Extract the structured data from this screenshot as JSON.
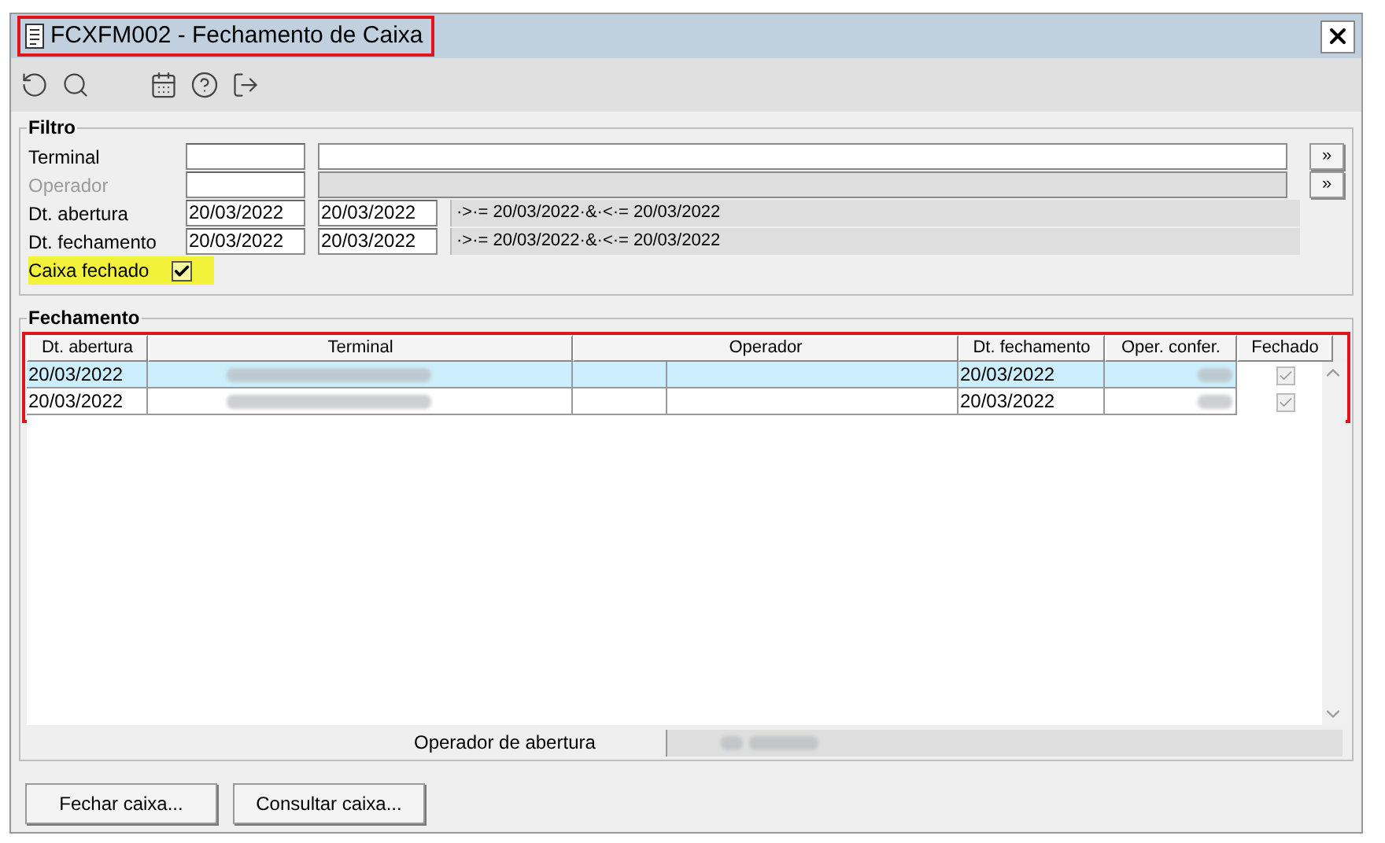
{
  "window": {
    "title": "FCXFM002 - Fechamento de Caixa",
    "outlined": true
  },
  "filter": {
    "title": "Filtro",
    "rows": [
      {
        "kind": "lookup",
        "label": "Terminal",
        "disabled": false,
        "button": "»"
      },
      {
        "kind": "lookup",
        "label": "Operador",
        "disabled": true,
        "button": "»"
      },
      {
        "kind": "range",
        "label": "Dt. abertura",
        "from": "20/03/2022",
        "to": "20/03/2022",
        "expression": "·>·= 20/03/2022·&·<·= 20/03/2022"
      },
      {
        "kind": "range",
        "label": "Dt. fechamento",
        "from": "20/03/2022",
        "to": "20/03/2022",
        "expression": "·>·= 20/03/2022·&·<·= 20/03/2022"
      }
    ],
    "checkbox": {
      "label": "Caixa fechado",
      "checked": true,
      "highlighted": true
    }
  },
  "grid": {
    "title": "Fechamento",
    "outlined": true,
    "columns": [
      "Dt. abertura",
      "Terminal",
      "Operador",
      "Dt. fechamento",
      "Oper. confer.",
      "Fechado"
    ],
    "rows": [
      {
        "selected": true,
        "dt_abertura": "20/03/2022",
        "terminal_redacted": true,
        "dt_fechamento": "20/03/2022",
        "oper_confer_redacted": true,
        "fechado": true
      },
      {
        "selected": false,
        "dt_abertura": "20/03/2022",
        "terminal_redacted": true,
        "dt_fechamento": "20/03/2022",
        "oper_confer_redacted": true,
        "fechado": true
      }
    ]
  },
  "footer": {
    "label": "Operador de abertura",
    "value_redacted": true
  },
  "buttons": [
    "Fechar caixa...",
    "Consultar caixa..."
  ]
}
